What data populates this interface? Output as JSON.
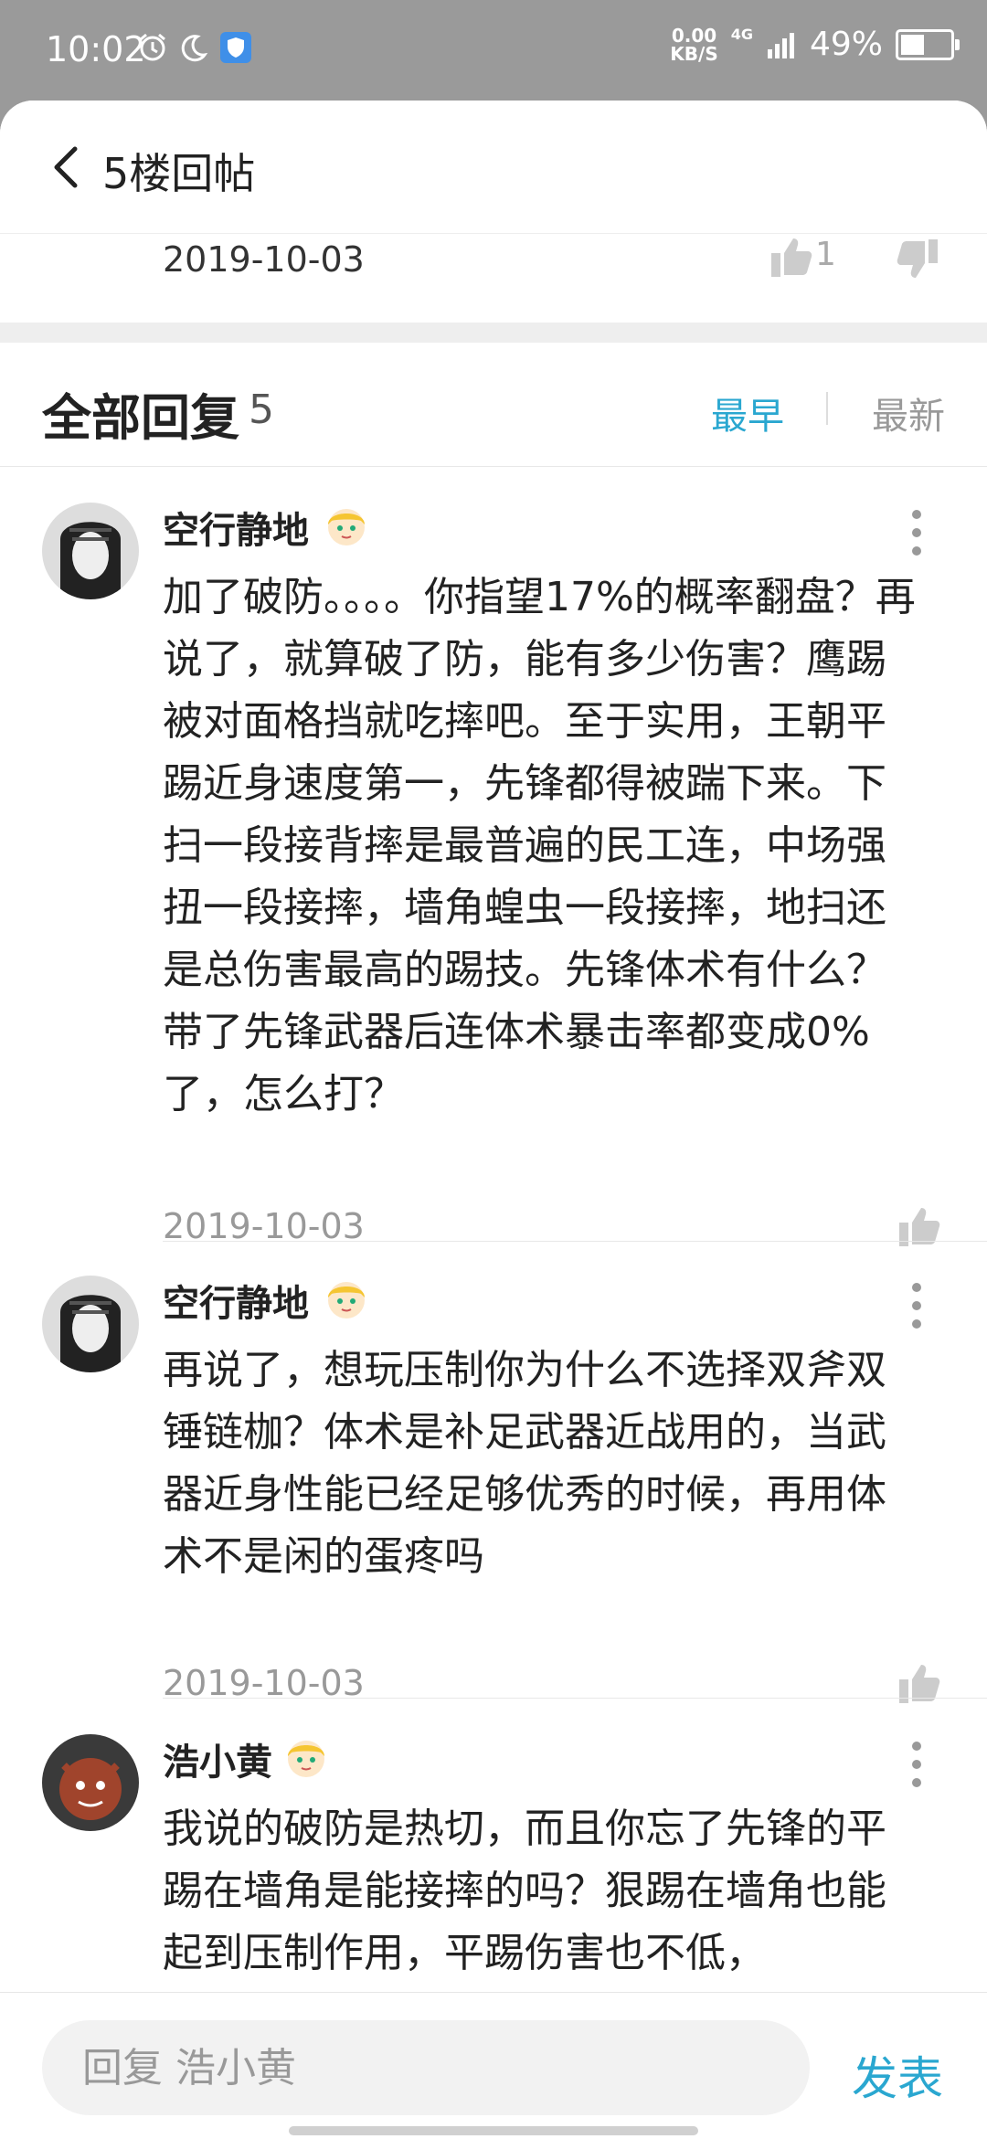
{
  "status_bar": {
    "time": "10:02",
    "speed_value": "0.00",
    "speed_unit": "KB/S",
    "network": "4G",
    "battery_percent_text": "49%",
    "battery_level": 0.49,
    "icons": [
      "alarm-icon",
      "moon-icon",
      "shield-icon",
      "signal-icon",
      "battery-icon"
    ]
  },
  "header": {
    "title": "5楼回帖",
    "back_icon": "chevron-left-icon"
  },
  "original_post": {
    "date": "2019-10-03",
    "like_count": "1"
  },
  "replies_section": {
    "title": "全部回复",
    "count": "5",
    "sort_earliest": "最早",
    "sort_latest": "最新",
    "active_sort": "最早"
  },
  "replies": [
    {
      "username": "空行静地",
      "text": "加了破防。。。。你指望17%的概率翻盘？再说了，就算破了防，能有多少伤害？鹰踢被对面格挡就吃摔吧。至于实用，王朝平踢近身速度第一，先锋都得被踹下来。下扫一段接背摔是最普遍的民工连，中场强扭一段接摔，墙角蝗虫一段接摔，地扫还是总伤害最高的踢技。先锋体术有什么？带了先锋武器后连体术暴击率都变成0%了，怎么打？",
      "date": "2019-10-03"
    },
    {
      "username": "空行静地",
      "text": "再说了，想玩压制你为什么不选择双斧双锤链枷？体术是补足武器近战用的，当武器近身性能已经足够优秀的时候，再用体术不是闲的蛋疼吗",
      "date": "2019-10-03"
    },
    {
      "username": "浩小黄",
      "text": "我说的破防是热切，而且你忘了先锋的平踢在墙角是能接摔的吗？狠踢在墙角也能起到压制作用，平踢伤害也不低，",
      "date": ""
    }
  ],
  "bottom_bar": {
    "input_placeholder": "回复 浩小黄",
    "send_label": "发表"
  },
  "colors": {
    "accent": "#2aa7d0",
    "status_bar": "#9a9a9a",
    "muted": "#999999"
  }
}
